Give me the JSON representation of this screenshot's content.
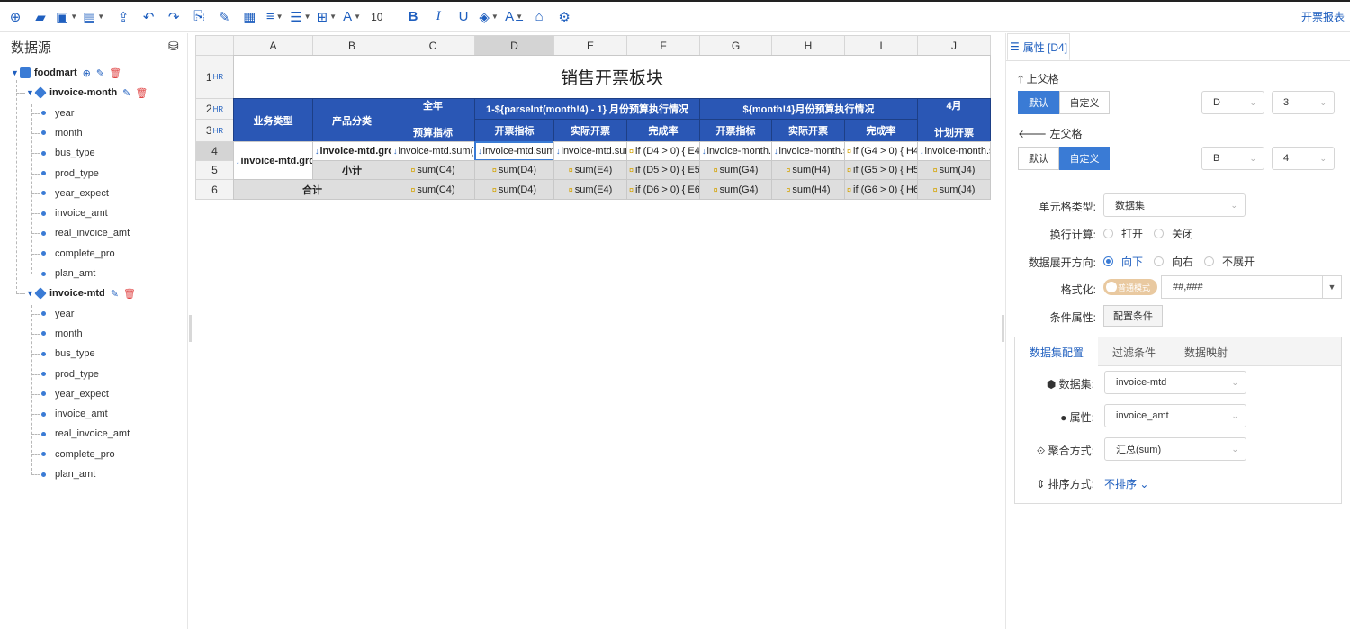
{
  "toolbar": {
    "font_size": "10",
    "bold_label": "B",
    "italic_label": "I",
    "underline_label": "U",
    "font_label": "A",
    "right_link": "开票报表"
  },
  "left": {
    "title": "数据源",
    "root": "foodmart",
    "datasets": [
      {
        "name": "invoice-month",
        "fields": [
          "year",
          "month",
          "bus_type",
          "prod_type",
          "year_expect",
          "invoice_amt",
          "real_invoice_amt",
          "complete_pro",
          "plan_amt"
        ]
      },
      {
        "name": "invoice-mtd",
        "fields": [
          "year",
          "month",
          "bus_type",
          "prod_type",
          "year_expect",
          "invoice_amt",
          "real_invoice_amt",
          "complete_pro",
          "plan_amt"
        ]
      }
    ]
  },
  "grid": {
    "columns": [
      "A",
      "B",
      "C",
      "D",
      "E",
      "F",
      "G",
      "H",
      "I",
      "J"
    ],
    "rows": [
      "1",
      "2",
      "3",
      "4",
      "5",
      "6"
    ],
    "hr_tag": "HR",
    "title": "销售开票板块",
    "h_bus_type": "业务类型",
    "h_prod_type": "产品分类",
    "h_year_1": "全年",
    "h_year_2": "预算指标",
    "h_group1": "1-${parseInt(month!4) - 1} 月份预算执行情况",
    "h_group2": "${month!4}月份预算执行情况",
    "h_april_1": "4月",
    "h_april_2": "计划开票",
    "h_kp": "开票指标",
    "h_sj": "实际开票",
    "h_wcl": "完成率",
    "r4": [
      "invoice-mtd.gro",
      "invoice-mtd.gro",
      "invoice-mtd.sum(",
      "invoice-mtd.sum",
      "invoice-mtd.sur",
      "if (D4 > 0) { E4",
      "invoice-month.s",
      "invoice-month.s",
      "if (G4 > 0) { H4",
      "invoice-month.s"
    ],
    "r5": [
      "小计",
      "sum(C4)",
      "sum(D4)",
      "sum(E4)",
      "if (D5 > 0) { E5",
      "sum(G4)",
      "sum(H4)",
      "if (G5 > 0) { H5",
      "sum(J4)"
    ],
    "r6": [
      "合计",
      "sum(C4)",
      "sum(D4)",
      "sum(E4)",
      "if (D6 > 0) { E6",
      "sum(G4)",
      "sum(H4)",
      "if (G6 > 0) { H6",
      "sum(J4)"
    ]
  },
  "right": {
    "tab_label": "属性 [D4]",
    "upper_parent": "上父格",
    "left_parent": "左父格",
    "default_label": "默认",
    "custom_label": "自定义",
    "upper_col": "D",
    "upper_row": "3",
    "left_col": "B",
    "left_row": "4",
    "cell_type_label": "单元格类型:",
    "cell_type_value": "数据集",
    "line_calc_label": "换行计算:",
    "open_label": "打开",
    "close_label": "关闭",
    "expand_label": "数据展开方向:",
    "down_label": "向下",
    "right_dir_label": "向右",
    "no_expand_label": "不展开",
    "format_label": "格式化:",
    "format_mode": "普通模式",
    "format_value": "##,###",
    "cond_label": "条件属性:",
    "cond_button": "配置条件",
    "panel_tabs": [
      "数据集配置",
      "过滤条件",
      "数据映射"
    ],
    "dataset_label": "数据集:",
    "dataset_value": "invoice-mtd",
    "attr_label": "属性:",
    "attr_value": "invoice_amt",
    "agg_label": "聚合方式:",
    "agg_value": "汇总(sum)",
    "sort_label": "排序方式:",
    "sort_value": "不排序"
  }
}
